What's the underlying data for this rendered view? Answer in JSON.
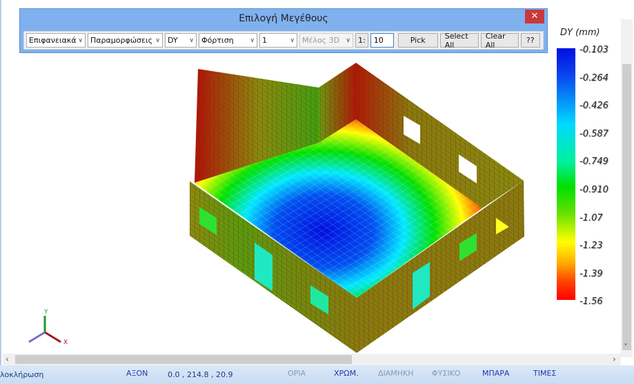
{
  "dialog": {
    "title": "Επιλογή Μεγέθους",
    "close": "✕",
    "selects": [
      "Επιφανειακά",
      "Παραμορφώσεις",
      "DY",
      "Φόρτιση",
      "1",
      "Μέλος 3D"
    ],
    "scale_label": "1:",
    "scale_value": "10",
    "pick": "Pick",
    "select_all": "Select All",
    "clear_all": "Clear All",
    "help": "??"
  },
  "legend": {
    "title": "DY (mm)",
    "values": [
      "-0.103",
      "-0.264",
      "-0.426",
      "-0.587",
      "-0.749",
      "-0.910",
      "-1.07",
      "-1.23",
      "-1.39",
      "-1.56"
    ]
  },
  "axes": {
    "x": "X",
    "y": "Y"
  },
  "status": {
    "left": "λοκλήρωση",
    "axon": "ΑΞΟΝ",
    "coords": "0.0 , 214.8 , 20.9",
    "oria": "ΟΡΙΑ",
    "xrom": "ΧΡΩΜ.",
    "diamikh": "ΔΙΑΜΗΚΗ",
    "fysiko": "ΦΥΣΙΚΟ",
    "mpara": "ΜΠΑΡΑ",
    "times": "ΤΙΜΕΣ"
  },
  "colors": {
    "min": "#ff0000",
    "max": "#0010e0",
    "wall": "#8a8a10"
  }
}
